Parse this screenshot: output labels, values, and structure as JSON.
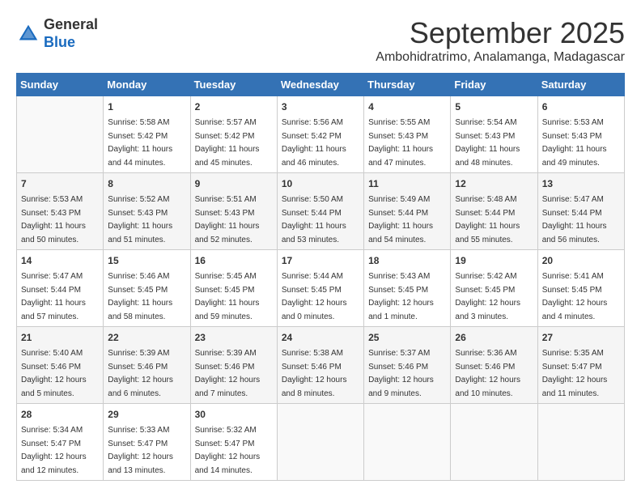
{
  "header": {
    "logo_line1": "General",
    "logo_line2": "Blue",
    "month": "September 2025",
    "location": "Ambohidratrimo, Analamanga, Madagascar"
  },
  "days_of_week": [
    "Sunday",
    "Monday",
    "Tuesday",
    "Wednesday",
    "Thursday",
    "Friday",
    "Saturday"
  ],
  "weeks": [
    [
      {
        "day": "",
        "sunrise": "",
        "sunset": "",
        "daylight": ""
      },
      {
        "day": "1",
        "sunrise": "Sunrise: 5:58 AM",
        "sunset": "Sunset: 5:42 PM",
        "daylight": "Daylight: 11 hours and 44 minutes."
      },
      {
        "day": "2",
        "sunrise": "Sunrise: 5:57 AM",
        "sunset": "Sunset: 5:42 PM",
        "daylight": "Daylight: 11 hours and 45 minutes."
      },
      {
        "day": "3",
        "sunrise": "Sunrise: 5:56 AM",
        "sunset": "Sunset: 5:42 PM",
        "daylight": "Daylight: 11 hours and 46 minutes."
      },
      {
        "day": "4",
        "sunrise": "Sunrise: 5:55 AM",
        "sunset": "Sunset: 5:43 PM",
        "daylight": "Daylight: 11 hours and 47 minutes."
      },
      {
        "day": "5",
        "sunrise": "Sunrise: 5:54 AM",
        "sunset": "Sunset: 5:43 PM",
        "daylight": "Daylight: 11 hours and 48 minutes."
      },
      {
        "day": "6",
        "sunrise": "Sunrise: 5:53 AM",
        "sunset": "Sunset: 5:43 PM",
        "daylight": "Daylight: 11 hours and 49 minutes."
      }
    ],
    [
      {
        "day": "7",
        "sunrise": "Sunrise: 5:53 AM",
        "sunset": "Sunset: 5:43 PM",
        "daylight": "Daylight: 11 hours and 50 minutes."
      },
      {
        "day": "8",
        "sunrise": "Sunrise: 5:52 AM",
        "sunset": "Sunset: 5:43 PM",
        "daylight": "Daylight: 11 hours and 51 minutes."
      },
      {
        "day": "9",
        "sunrise": "Sunrise: 5:51 AM",
        "sunset": "Sunset: 5:43 PM",
        "daylight": "Daylight: 11 hours and 52 minutes."
      },
      {
        "day": "10",
        "sunrise": "Sunrise: 5:50 AM",
        "sunset": "Sunset: 5:44 PM",
        "daylight": "Daylight: 11 hours and 53 minutes."
      },
      {
        "day": "11",
        "sunrise": "Sunrise: 5:49 AM",
        "sunset": "Sunset: 5:44 PM",
        "daylight": "Daylight: 11 hours and 54 minutes."
      },
      {
        "day": "12",
        "sunrise": "Sunrise: 5:48 AM",
        "sunset": "Sunset: 5:44 PM",
        "daylight": "Daylight: 11 hours and 55 minutes."
      },
      {
        "day": "13",
        "sunrise": "Sunrise: 5:47 AM",
        "sunset": "Sunset: 5:44 PM",
        "daylight": "Daylight: 11 hours and 56 minutes."
      }
    ],
    [
      {
        "day": "14",
        "sunrise": "Sunrise: 5:47 AM",
        "sunset": "Sunset: 5:44 PM",
        "daylight": "Daylight: 11 hours and 57 minutes."
      },
      {
        "day": "15",
        "sunrise": "Sunrise: 5:46 AM",
        "sunset": "Sunset: 5:45 PM",
        "daylight": "Daylight: 11 hours and 58 minutes."
      },
      {
        "day": "16",
        "sunrise": "Sunrise: 5:45 AM",
        "sunset": "Sunset: 5:45 PM",
        "daylight": "Daylight: 11 hours and 59 minutes."
      },
      {
        "day": "17",
        "sunrise": "Sunrise: 5:44 AM",
        "sunset": "Sunset: 5:45 PM",
        "daylight": "Daylight: 12 hours and 0 minutes."
      },
      {
        "day": "18",
        "sunrise": "Sunrise: 5:43 AM",
        "sunset": "Sunset: 5:45 PM",
        "daylight": "Daylight: 12 hours and 1 minute."
      },
      {
        "day": "19",
        "sunrise": "Sunrise: 5:42 AM",
        "sunset": "Sunset: 5:45 PM",
        "daylight": "Daylight: 12 hours and 3 minutes."
      },
      {
        "day": "20",
        "sunrise": "Sunrise: 5:41 AM",
        "sunset": "Sunset: 5:45 PM",
        "daylight": "Daylight: 12 hours and 4 minutes."
      }
    ],
    [
      {
        "day": "21",
        "sunrise": "Sunrise: 5:40 AM",
        "sunset": "Sunset: 5:46 PM",
        "daylight": "Daylight: 12 hours and 5 minutes."
      },
      {
        "day": "22",
        "sunrise": "Sunrise: 5:39 AM",
        "sunset": "Sunset: 5:46 PM",
        "daylight": "Daylight: 12 hours and 6 minutes."
      },
      {
        "day": "23",
        "sunrise": "Sunrise: 5:39 AM",
        "sunset": "Sunset: 5:46 PM",
        "daylight": "Daylight: 12 hours and 7 minutes."
      },
      {
        "day": "24",
        "sunrise": "Sunrise: 5:38 AM",
        "sunset": "Sunset: 5:46 PM",
        "daylight": "Daylight: 12 hours and 8 minutes."
      },
      {
        "day": "25",
        "sunrise": "Sunrise: 5:37 AM",
        "sunset": "Sunset: 5:46 PM",
        "daylight": "Daylight: 12 hours and 9 minutes."
      },
      {
        "day": "26",
        "sunrise": "Sunrise: 5:36 AM",
        "sunset": "Sunset: 5:46 PM",
        "daylight": "Daylight: 12 hours and 10 minutes."
      },
      {
        "day": "27",
        "sunrise": "Sunrise: 5:35 AM",
        "sunset": "Sunset: 5:47 PM",
        "daylight": "Daylight: 12 hours and 11 minutes."
      }
    ],
    [
      {
        "day": "28",
        "sunrise": "Sunrise: 5:34 AM",
        "sunset": "Sunset: 5:47 PM",
        "daylight": "Daylight: 12 hours and 12 minutes."
      },
      {
        "day": "29",
        "sunrise": "Sunrise: 5:33 AM",
        "sunset": "Sunset: 5:47 PM",
        "daylight": "Daylight: 12 hours and 13 minutes."
      },
      {
        "day": "30",
        "sunrise": "Sunrise: 5:32 AM",
        "sunset": "Sunset: 5:47 PM",
        "daylight": "Daylight: 12 hours and 14 minutes."
      },
      {
        "day": "",
        "sunrise": "",
        "sunset": "",
        "daylight": ""
      },
      {
        "day": "",
        "sunrise": "",
        "sunset": "",
        "daylight": ""
      },
      {
        "day": "",
        "sunrise": "",
        "sunset": "",
        "daylight": ""
      },
      {
        "day": "",
        "sunrise": "",
        "sunset": "",
        "daylight": ""
      }
    ]
  ]
}
